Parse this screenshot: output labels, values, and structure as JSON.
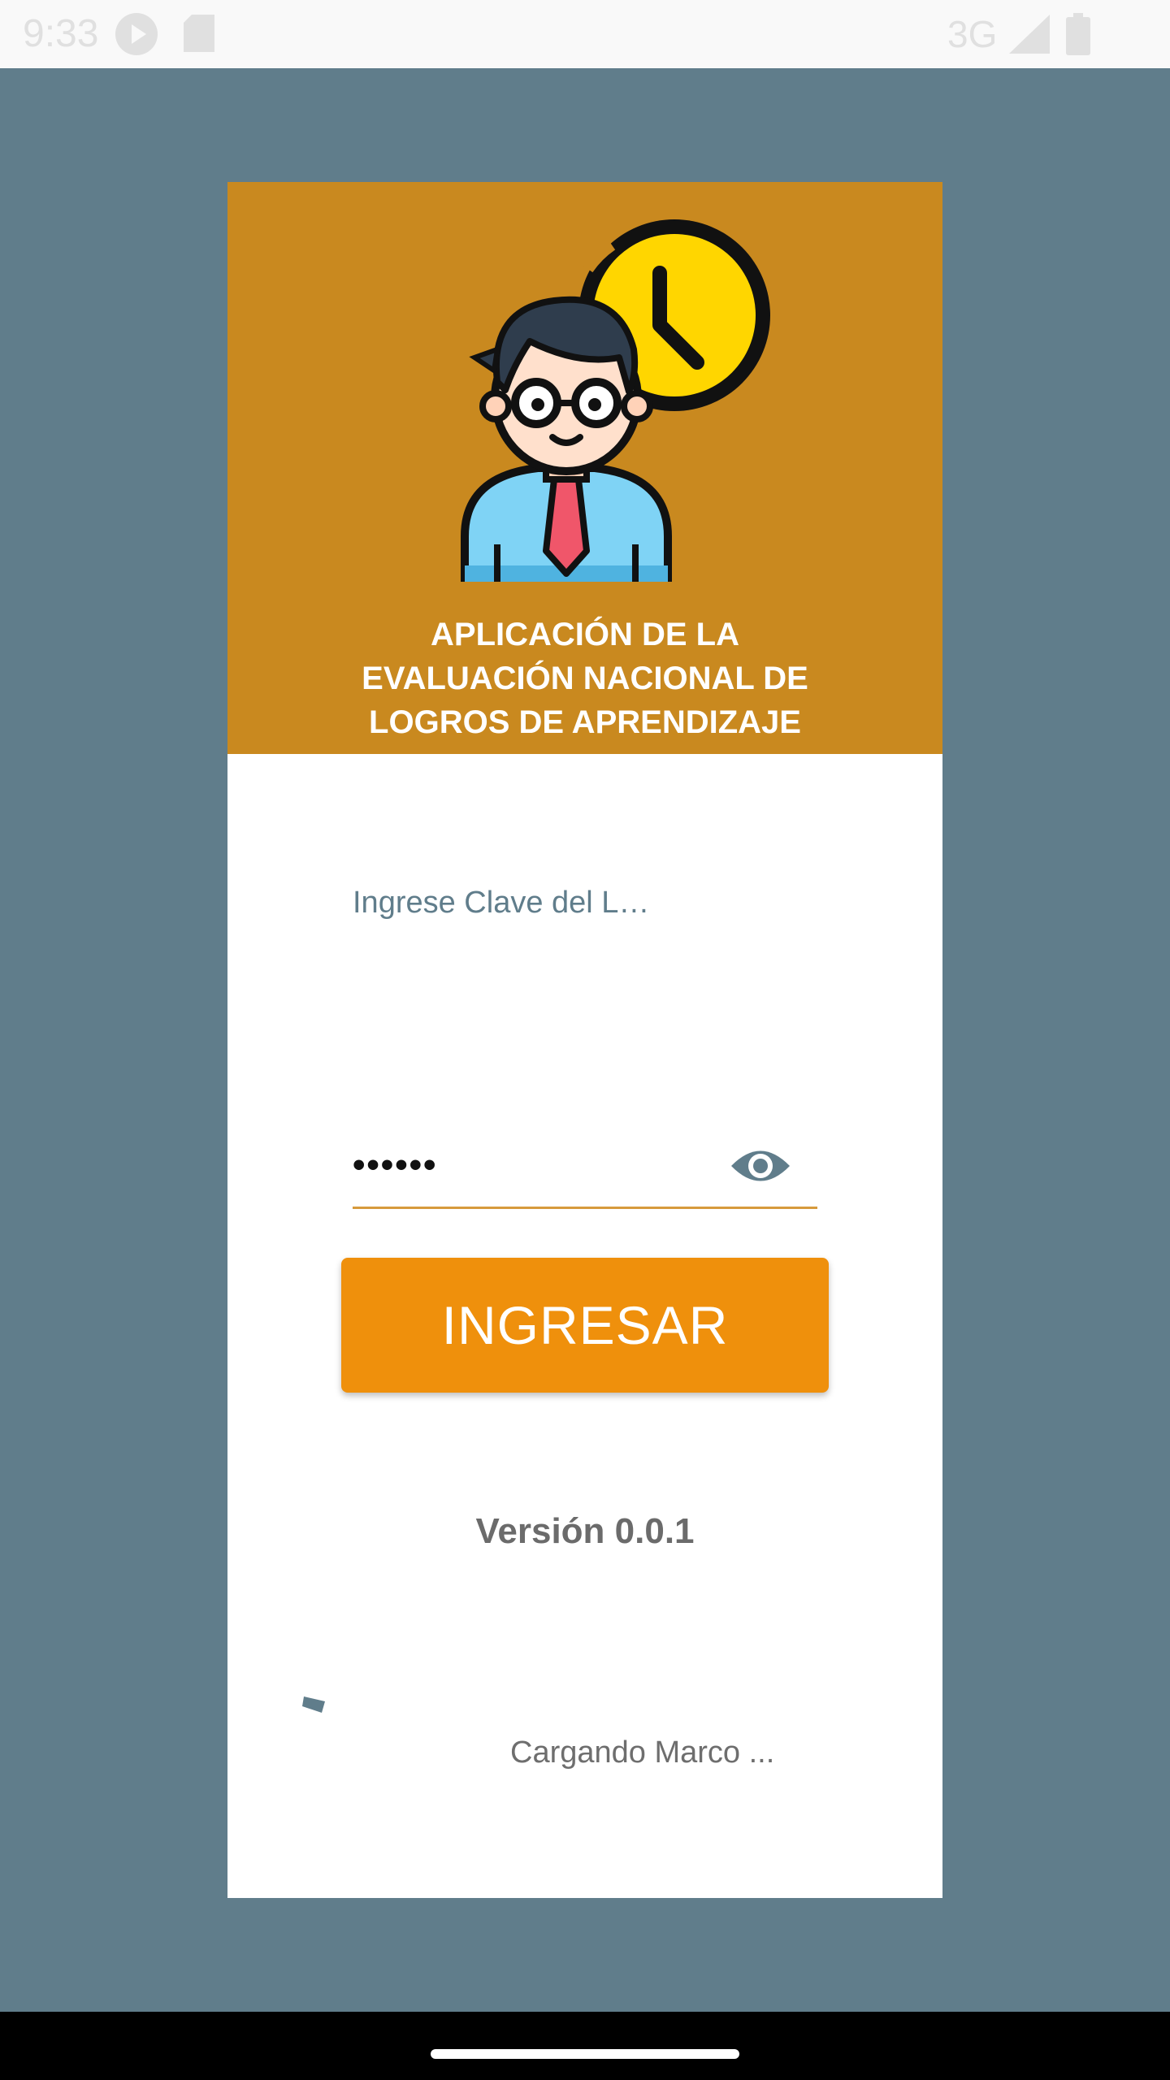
{
  "status_bar": {
    "time": "9:33",
    "network": "3G",
    "icons": [
      "play-icon",
      "sd-card-icon",
      "signal-icon",
      "battery-icon"
    ]
  },
  "header": {
    "title": "APLICACIÓN DE LA\nEVALUACIÓN NACIONAL DE\nLOGROS DE APRENDIZAJE",
    "illustration": "teacher-with-clock-icon",
    "background_color": "#c9891f"
  },
  "login": {
    "field_label": "Ingrese Clave  del L…",
    "password_value": "••••••",
    "toggle_icon": "eye-icon",
    "button_label": "INGRESAR",
    "button_color": "#ef900c"
  },
  "footer": {
    "version": "Versión 0.0.1",
    "loading_text": "Cargando Marco ..."
  },
  "colors": {
    "page_background": "#607d8b",
    "accent": "#ef900c"
  }
}
